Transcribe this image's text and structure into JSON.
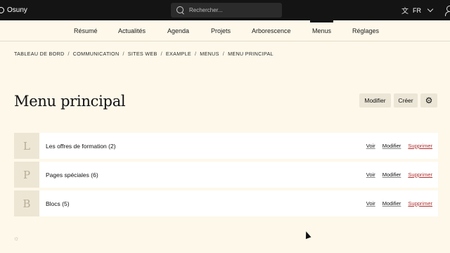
{
  "topbar": {
    "brand": "Osuny",
    "search_placeholder": "Rechercher...",
    "language": "FR"
  },
  "nav": {
    "items": [
      {
        "label": "Résumé"
      },
      {
        "label": "Actualités"
      },
      {
        "label": "Agenda"
      },
      {
        "label": "Projets"
      },
      {
        "label": "Arborescence"
      },
      {
        "label": "Menus"
      },
      {
        "label": "Réglages"
      }
    ],
    "active": "Menus"
  },
  "breadcrumb": [
    "TABLEAU DE BORD",
    "COMMUNICATION",
    "SITES WEB",
    "EXAMPLE",
    "MENUS",
    "MENU PRINCIPAL"
  ],
  "page": {
    "title": "Menu principal",
    "modify_label": "Modifier",
    "create_label": "Créer"
  },
  "items": [
    {
      "letter": "L",
      "title": "Les offres de formation (2)",
      "view": "Voir",
      "edit": "Modifier",
      "delete": "Supprimer"
    },
    {
      "letter": "P",
      "title": "Pages spéciales (6)",
      "view": "Voir",
      "edit": "Modifier",
      "delete": "Supprimer"
    },
    {
      "letter": "B",
      "title": "Blocs (5)",
      "view": "Voir",
      "edit": "Modifier",
      "delete": "Supprimer"
    }
  ],
  "icons": {
    "brand": "osuny-logo-icon",
    "search": "search-icon",
    "translate": "translate-icon",
    "user": "user-icon",
    "settings": "gear-icon"
  }
}
